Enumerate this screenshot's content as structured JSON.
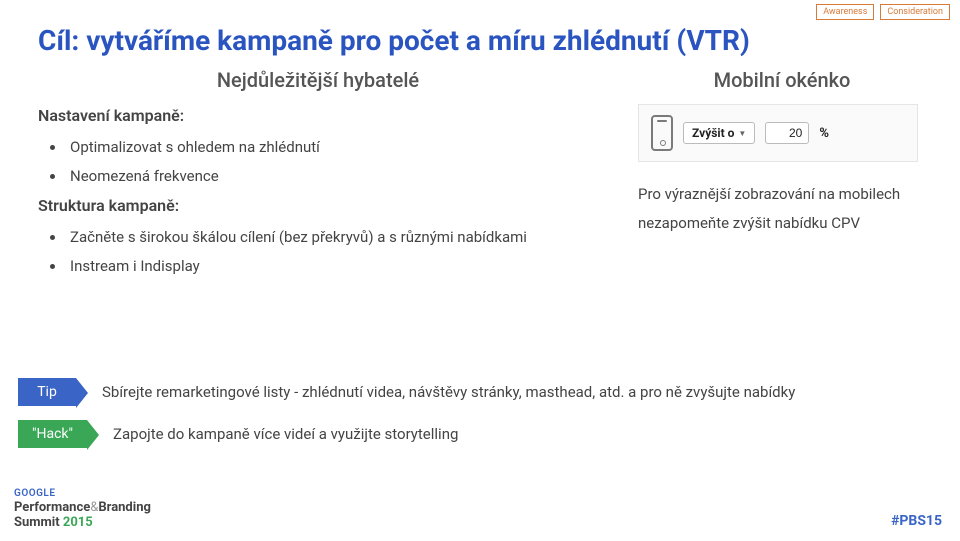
{
  "topTags": {
    "awareness": "Awareness",
    "consideration": "Consideration"
  },
  "title": "Cíl: vytváříme kampaně pro počet a míru zhlédnutí (VTR)",
  "subLeft": "Nejdůležitější hybatelé",
  "subRight": "Mobilní okénko",
  "section1Label": "Nastavení kampaně:",
  "section1": {
    "b1": "Optimalizovat s ohledem na zhlédnutí",
    "b2": "Neomezená frekvence"
  },
  "section2Label": "Struktura kampaně:",
  "section2": {
    "b1": "Začněte s širokou škálou cílení (bez překryvů) a s různými nabídkami",
    "b2": "Instream i Indisplay"
  },
  "widget": {
    "buttonLabel": "Zvýšit o",
    "value": "20",
    "unit": "%"
  },
  "rightPara": "Pro výraznější zobrazování na mobilech nezapomeňte zvýšit nabídku CPV",
  "tip": {
    "label": "Tip",
    "text": "Sbírejte remarketingové listy - zhlédnutí videa, návštěvy stránky, masthead, atd. a pro ně zvyšujte nabídky"
  },
  "hack": {
    "label": "\"Hack\"",
    "text": "Zapojte do kampaně více videí a využijte storytelling"
  },
  "footer": {
    "google": "GOOGLE",
    "brand1": "Performance",
    "amp": "&",
    "brand2": "Branding",
    "summit": "Summit",
    "year": "2015",
    "hashtag": "#PBS15"
  }
}
